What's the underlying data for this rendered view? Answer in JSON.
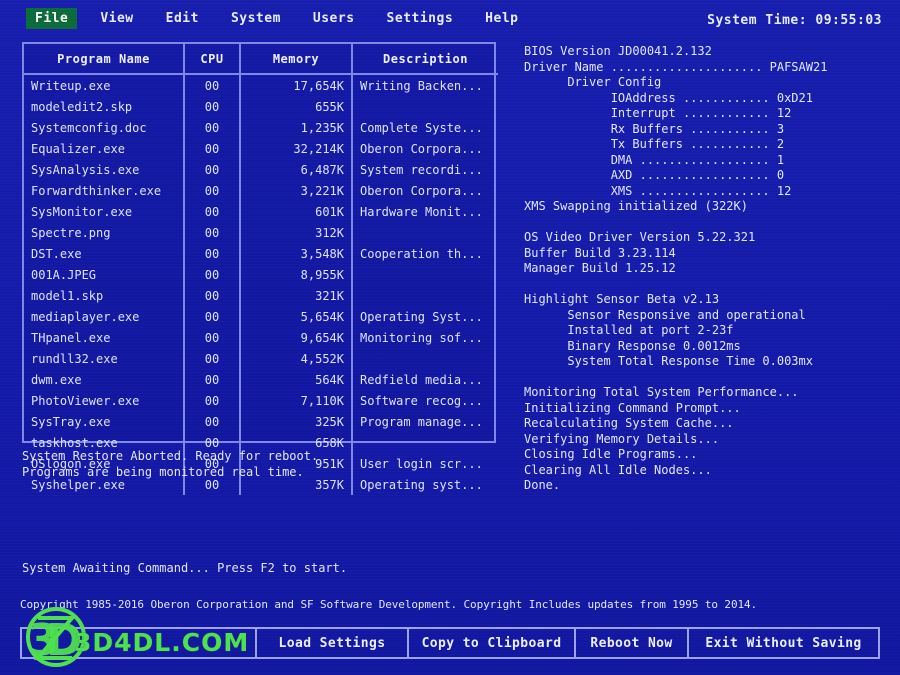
{
  "menu": {
    "items": [
      {
        "label": "File",
        "active": true
      },
      {
        "label": "View",
        "active": false
      },
      {
        "label": "Edit",
        "active": false
      },
      {
        "label": "System",
        "active": false
      },
      {
        "label": "Users",
        "active": false
      },
      {
        "label": "Settings",
        "active": false
      },
      {
        "label": "Help",
        "active": false
      }
    ],
    "system_time": "System Time: 09:55:03"
  },
  "table": {
    "headers": [
      "Program Name",
      "CPU",
      "Memory",
      "Description"
    ],
    "rows": [
      {
        "name": "Writeup.exe",
        "cpu": "00",
        "memory": "17,654K",
        "description": "Writing Backen..."
      },
      {
        "name": "modeledit2.skp",
        "cpu": "00",
        "memory": "655K",
        "description": ""
      },
      {
        "name": "Systemconfig.doc",
        "cpu": "00",
        "memory": "1,235K",
        "description": "Complete Syste..."
      },
      {
        "name": "Equalizer.exe",
        "cpu": "00",
        "memory": "32,214K",
        "description": "Oberon Corpora..."
      },
      {
        "name": "SysAnalysis.exe",
        "cpu": "00",
        "memory": "6,487K",
        "description": "System recordi..."
      },
      {
        "name": "Forwardthinker.exe",
        "cpu": "00",
        "memory": "3,221K",
        "description": "Oberon Corpora..."
      },
      {
        "name": "SysMonitor.exe",
        "cpu": "00",
        "memory": "601K",
        "description": "Hardware Monit..."
      },
      {
        "name": "Spectre.png",
        "cpu": "00",
        "memory": "312K",
        "description": ""
      },
      {
        "name": "DST.exe",
        "cpu": "00",
        "memory": "3,548K",
        "description": "Cooperation th..."
      },
      {
        "name": "001A.JPEG",
        "cpu": "00",
        "memory": "8,955K",
        "description": ""
      },
      {
        "name": "model1.skp",
        "cpu": "00",
        "memory": "321K",
        "description": ""
      },
      {
        "name": "mediaplayer.exe",
        "cpu": "00",
        "memory": "5,654K",
        "description": "Operating Syst..."
      },
      {
        "name": "THpanel.exe",
        "cpu": "00",
        "memory": "9,654K",
        "description": "Monitoring sof..."
      },
      {
        "name": "rundll32.exe",
        "cpu": "00",
        "memory": "4,552K",
        "description": ""
      },
      {
        "name": "dwm.exe",
        "cpu": "00",
        "memory": "564K",
        "description": "Redfield media..."
      },
      {
        "name": "PhotoViewer.exe",
        "cpu": "00",
        "memory": "7,110K",
        "description": "Software recog..."
      },
      {
        "name": "SysTray.exe",
        "cpu": "00",
        "memory": "325K",
        "description": "Program manage..."
      },
      {
        "name": "taskhost.exe",
        "cpu": "00",
        "memory": "658K",
        "description": ""
      },
      {
        "name": "OSlogon.exe",
        "cpu": "00",
        "memory": "951K",
        "description": "User login scr..."
      },
      {
        "name": "Syshelper.exe",
        "cpu": "00",
        "memory": "357K",
        "description": "Operating syst..."
      }
    ]
  },
  "console": {
    "lines": [
      "BIOS Version JD00041.2.132",
      "Driver Name ..................... PAFSAW21",
      "      Driver Config",
      "            IOAddress ............ 0xD21",
      "            Interrupt ............ 12",
      "            Rx Buffers ........... 3",
      "            Tx Buffers ........... 2",
      "            DMA .................. 1",
      "            AXD .................. 0",
      "            XMS .................. 12",
      "XMS Swapping initialized (322K)",
      "",
      "OS Video Driver Version 5.22.321",
      "Buffer Build 3.23.114",
      "Manager Build 1.25.12",
      "",
      "Highlight Sensor Beta v2.13",
      "      Sensor Responsive and operational",
      "      Installed at port 2-23f",
      "      Binary Response 0.0012ms",
      "      System Total Response Time 0.003mx",
      "",
      "Monitoring Total System Performance...",
      "Initializing Command Prompt...",
      "Recalculating System Cache...",
      "Verifying Memory Details...",
      "Closing Idle Programs...",
      "Clearing All Idle Nodes...",
      "Done."
    ]
  },
  "status": {
    "lines": [
      "System Restore Aborted. Ready for reboot.",
      "Programs are being monitored real time."
    ],
    "awaiting": "System Awaiting Command... Press F2 to start.",
    "copyright": "Copyright 1985-2016 Oberon Corporation and SF Software Development. Copyright Includes updates from 1995 to 2014."
  },
  "buttons": [
    {
      "label": "",
      "name": "blank-button"
    },
    {
      "label": "Load Settings",
      "name": "load-settings-button"
    },
    {
      "label": "Copy to Clipboard",
      "name": "copy-to-clipboard-button"
    },
    {
      "label": "Reboot Now",
      "name": "reboot-now-button"
    },
    {
      "label": "Exit Without Saving",
      "name": "exit-without-saving-button"
    }
  ],
  "watermark": {
    "text": "3D4DL.COM",
    "color": "#4ee04e"
  },
  "colors": {
    "background": "#151cad",
    "text": "#dfe3ff",
    "border": "#7f87e8",
    "menu_highlight": "#0b6b3a",
    "watermark": "#4ee04e"
  }
}
